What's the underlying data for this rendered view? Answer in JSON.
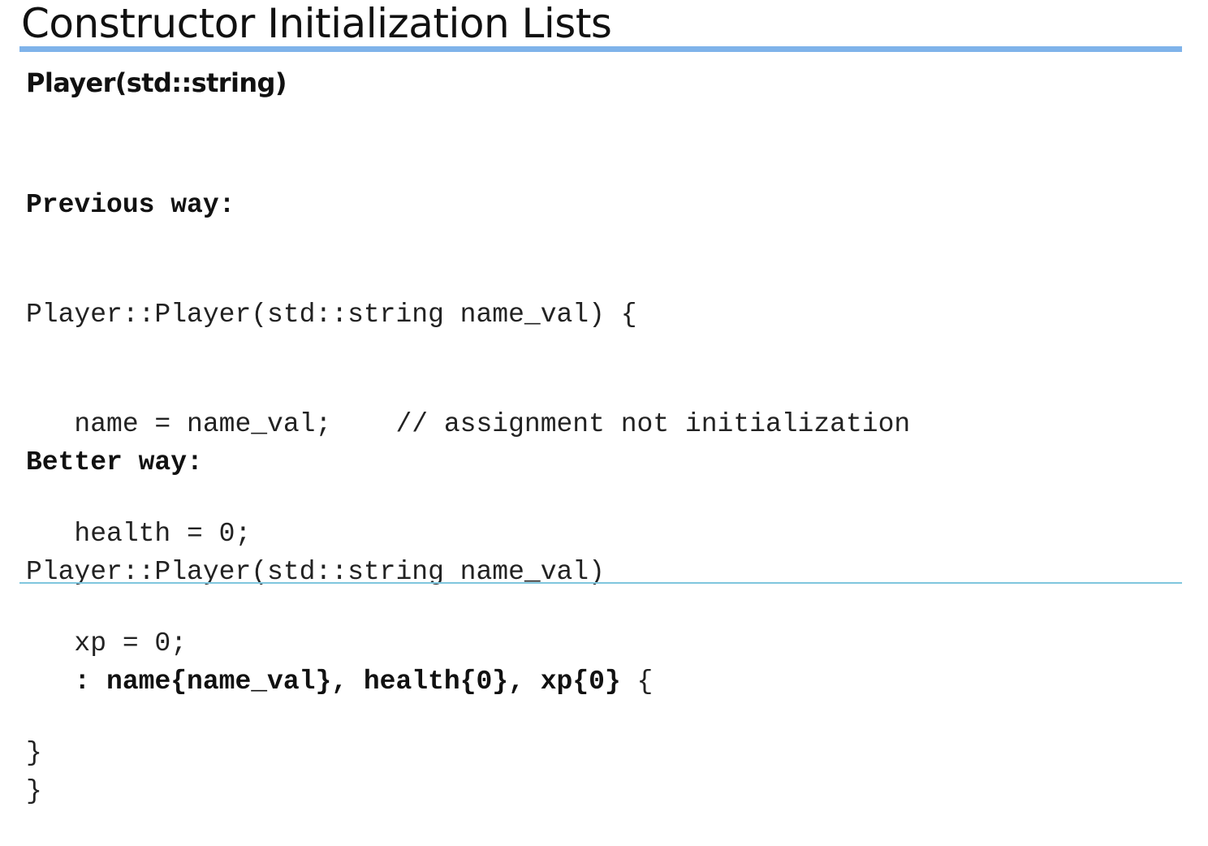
{
  "slide": {
    "title": "Constructor Initialization Lists",
    "subtitle": "Player(std::string)"
  },
  "previous_way": {
    "heading": "Previous way:",
    "lines": [
      "Player::Player(std::string name_val) {",
      "   name = name_val;    // assignment not initialization",
      "   health = 0;",
      "   xp = 0;",
      "}"
    ]
  },
  "better_way": {
    "heading": "Better way:",
    "signature": "Player::Player(std::string name_val)",
    "indent": "   ",
    "init_list": ": name{name_val}, health{0}, xp{0}",
    "open_brace": " {",
    "closing": "}"
  },
  "colors": {
    "accent_rule": "#7fb3ea",
    "bottom_rule": "#7fc6de"
  }
}
